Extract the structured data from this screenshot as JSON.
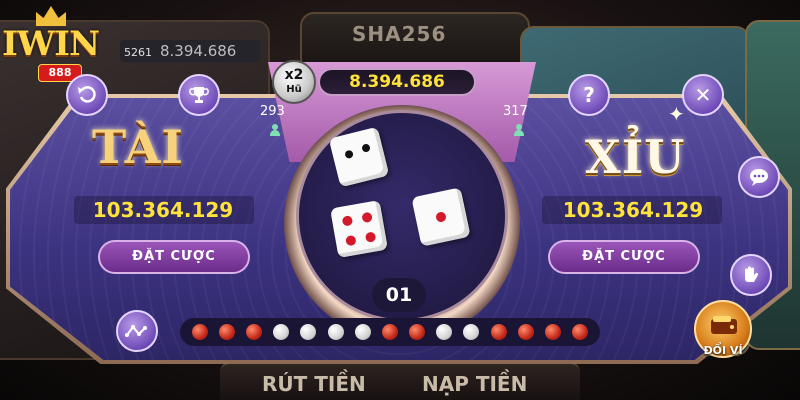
{
  "logo": {
    "brand": "IWIN",
    "sub": "888"
  },
  "background": {
    "center_title": "SHA256",
    "balance_tag": "5261",
    "balance": "8.394.686",
    "bottom_withdraw": "RÚT TIỀN",
    "bottom_deposit": "NẠP TIỀN"
  },
  "jackpot": {
    "multiplier": "x2",
    "label": "Hũ",
    "value": "8.394.686",
    "tai_players": "293",
    "xiu_players": "317"
  },
  "tai": {
    "title": "TÀI",
    "total": "103.364.129",
    "bet_label": "ĐẶT CƯỢC"
  },
  "xiu": {
    "title": "XỈU",
    "total": "103.364.129",
    "bet_label": "ĐẶT CƯỢC"
  },
  "round_number": "01",
  "dice": [
    2,
    4,
    1
  ],
  "history": [
    "red",
    "red",
    "red",
    "white",
    "white",
    "white",
    "white",
    "red",
    "red",
    "white",
    "white",
    "red",
    "red",
    "red",
    "red"
  ],
  "buttons": {
    "back_icon": "back-arrow-icon",
    "trophy_icon": "trophy-icon",
    "help": "?",
    "close": "✕",
    "chat_icon": "chat-icon",
    "hand_icon": "hand-icon",
    "stats_icon": "stats-icon"
  },
  "wallet_label": "ĐỔI VÍ",
  "colors": {
    "panel": "#4b4292",
    "gold": "#ffe33a",
    "accent": "#9a55b8"
  }
}
